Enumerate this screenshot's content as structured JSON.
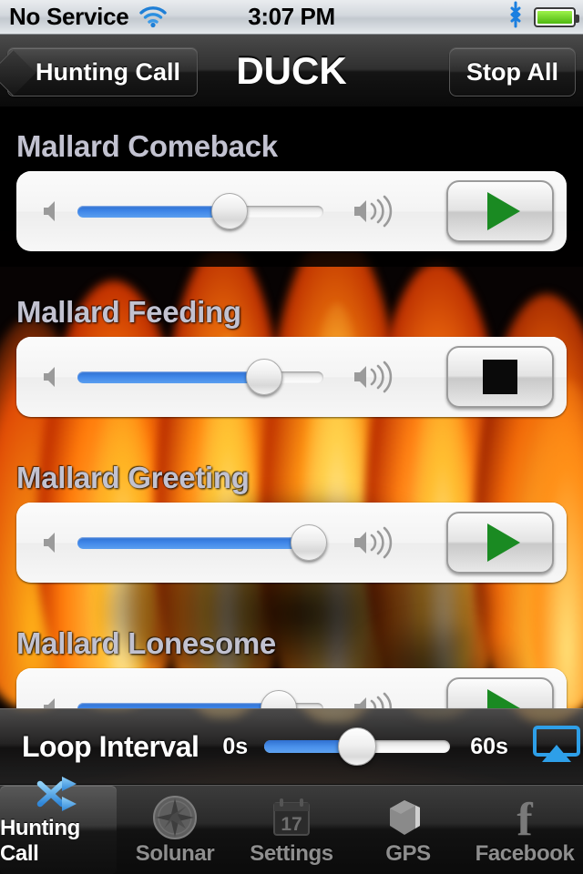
{
  "status_bar": {
    "carrier": "No Service",
    "time": "3:07 PM",
    "wifi_icon": "wifi-icon",
    "bluetooth_icon": "bluetooth-icon",
    "battery_icon": "battery-full-icon"
  },
  "nav_bar": {
    "back_label": "Hunting Call",
    "title": "DUCK",
    "stop_all_label": "Stop All"
  },
  "calls": [
    {
      "name": "Mallard Comeback",
      "volume": 62,
      "state": "stopped",
      "button_icon": "play-icon",
      "low_icon": "speaker-low-icon",
      "high_icon": "speaker-high-icon"
    },
    {
      "name": "Mallard Feeding",
      "volume": 76,
      "state": "playing",
      "button_icon": "stop-icon",
      "low_icon": "speaker-low-icon",
      "high_icon": "speaker-high-icon"
    },
    {
      "name": "Mallard Greeting",
      "volume": 94,
      "state": "stopped",
      "button_icon": "play-icon",
      "low_icon": "speaker-low-icon",
      "high_icon": "speaker-high-icon"
    },
    {
      "name": "Mallard Lonesome",
      "volume": 82,
      "state": "stopped",
      "button_icon": "play-icon",
      "low_icon": "speaker-low-icon",
      "high_icon": "speaker-high-icon"
    }
  ],
  "loop_bar": {
    "title": "Loop Interval",
    "min_label": "0s",
    "max_label": "60s",
    "value_percent": 50,
    "airplay_icon": "airplay-icon"
  },
  "tab_bar": {
    "tabs": [
      {
        "label": "Hunting Call",
        "icon": "shuffle-icon",
        "active": true
      },
      {
        "label": "Solunar",
        "icon": "compass-icon",
        "active": false
      },
      {
        "label": "Settings",
        "icon": "calendar-icon",
        "active": false
      },
      {
        "label": "GPS",
        "icon": "cube-icon",
        "active": false
      },
      {
        "label": "Facebook",
        "icon": "facebook-icon",
        "active": false
      }
    ],
    "calendar_day": "17"
  },
  "colors": {
    "accent_blue": "#3f86e8",
    "play_green": "#1a8a22",
    "label_lavender": "#c2c2d0",
    "airplay_blue": "#2e9fe8",
    "flame_orange": "#ff6a10",
    "flame_yellow": "#ffd34a"
  }
}
